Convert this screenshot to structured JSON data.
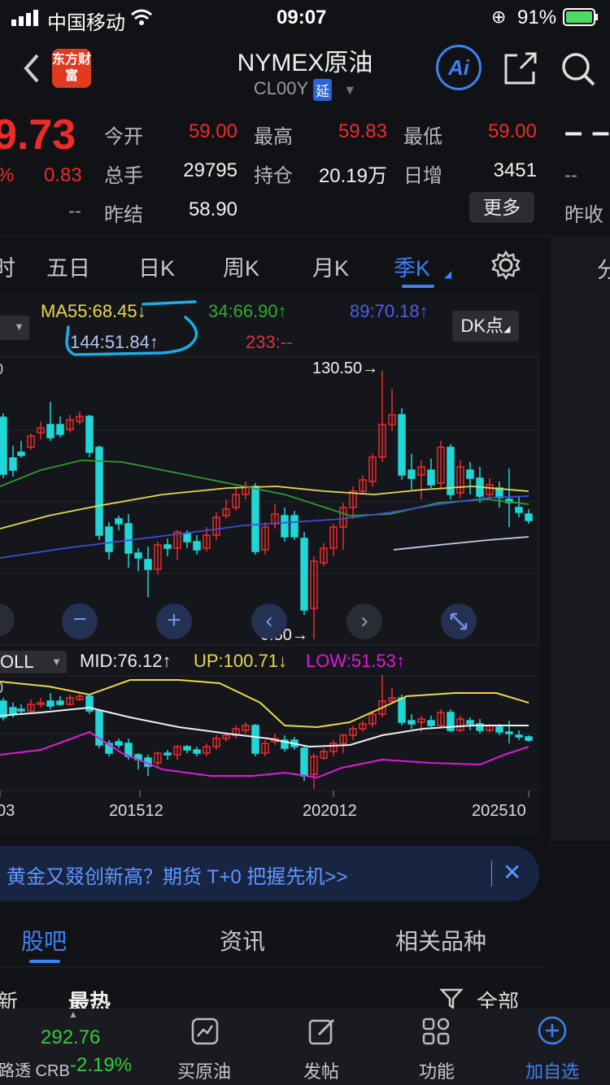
{
  "status_bar": {
    "carrier": "中国移动",
    "time": "09:07",
    "battery": "91%"
  },
  "header": {
    "title": "NYMEX原油",
    "code": "CL00Y",
    "delay_badge": "延",
    "logo_text": "东方财富",
    "ai_label": "Ai"
  },
  "quote": {
    "price": "9.73",
    "change_pct": "%",
    "change": "0.83",
    "dash_left": "--",
    "labels": {
      "open": "今开",
      "high": "最高",
      "low": "最低",
      "volume": "总手",
      "position": "持仓",
      "daily_inc": "日增",
      "prev_settle": "昨结",
      "prev_close": "昨收"
    },
    "values": {
      "open": "59.00",
      "high": "59.83",
      "low": "59.00",
      "volume": "29795",
      "position": "20.19万",
      "daily_inc": "3451",
      "prev_settle": "58.90"
    },
    "right_dash_big": "– –",
    "right_dash": "--",
    "more_button": "更多"
  },
  "period_tabs": [
    "时",
    "五日",
    "日K",
    "周K",
    "月K",
    "季K"
  ],
  "period_tab_active": "季K",
  "right_tab": "分",
  "ma_legend": {
    "ma55": "MA55:68.45↓",
    "ma34": "34:66.90↑",
    "ma89": "89:70.18↑",
    "ma144": "144:51.84↑",
    "ma233": "233:--",
    "dk_button": "DK点"
  },
  "price_labels": {
    "high": "130.50→",
    "low": "6.50→",
    "axis_top": "0"
  },
  "boll_legend": {
    "name": "OLL",
    "mid": "MID:76.12↑",
    "up": "UP:100.71↓",
    "low": "LOW:51.53↑",
    "axis_top": "0"
  },
  "x_axis": [
    "03",
    "201512",
    "202012",
    "202510"
  ],
  "banner": {
    "text": "黄金又叕创新高？期货 T+0 把握先机>>",
    "close": "✕"
  },
  "bottom_tabs": [
    "股吧",
    "资讯",
    "相关品种"
  ],
  "bottom_tab_active": "股吧",
  "sub_tabs": {
    "new": "新",
    "hot": "最热",
    "filter": "全部"
  },
  "bottom_nav": {
    "index_value": "292.76",
    "index_name": "路透 CRB",
    "index_change": "-2.19%",
    "items": [
      "买原油",
      "发帖",
      "功能",
      "加自选"
    ]
  },
  "colors": {
    "up": "#ee2a2a",
    "down": "#20d6d6",
    "accent": "#3b82f6",
    "ma55": "#e9d84a",
    "ma34": "#2e9b2e",
    "ma89": "#3d4fd8",
    "boll_low": "#e01ad8"
  }
}
